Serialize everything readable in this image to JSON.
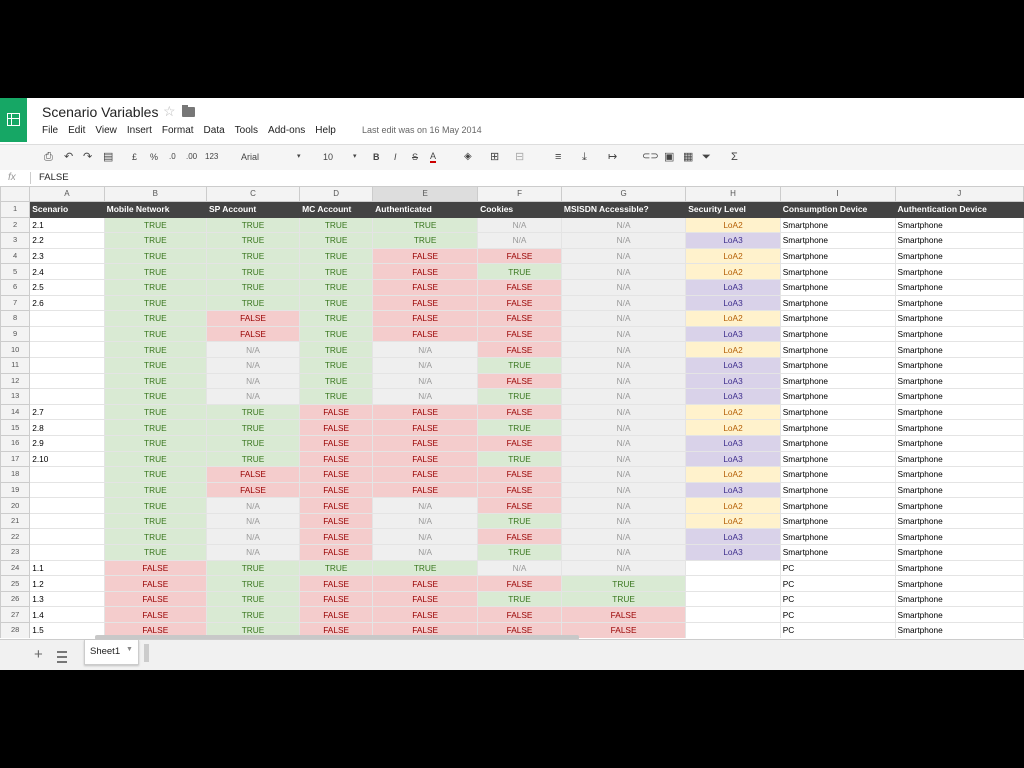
{
  "title_bar": {
    "doc_title": "Scenario Variables",
    "menu": [
      "File",
      "Edit",
      "View",
      "Insert",
      "Format",
      "Data",
      "Tools",
      "Add-ons",
      "Help"
    ],
    "last_edit": "Last edit was on 16 May 2014",
    "brand_color": "#16a765"
  },
  "toolbar": {
    "currency": "£",
    "percent": "%",
    "decrease_decimals": ".0",
    "increase_decimals": ".00",
    "more_formats": "123",
    "font": "Arial",
    "font_size": "10",
    "bold": "B",
    "italic": "I",
    "strikethrough": "S",
    "text_color": "A",
    "functions": "Σ"
  },
  "formula_bar": {
    "label": "fx",
    "value": "FALSE"
  },
  "sheet": {
    "columns": [
      "A",
      "B",
      "C",
      "D",
      "E",
      "F",
      "G",
      "H",
      "I",
      "J"
    ],
    "header_row": [
      "Scenario",
      "Mobile Network",
      "SP Account",
      "MC Account",
      "Authenticated",
      "Cookies",
      "MSISDN Accessible?",
      "Security Level",
      "Consumption Device",
      "Authentication Device"
    ],
    "rows": [
      [
        "2.1",
        "TRUE",
        "TRUE",
        "TRUE",
        "TRUE",
        "N/A",
        "N/A",
        "LoA2",
        "Smartphone",
        "Smartphone"
      ],
      [
        "2.2",
        "TRUE",
        "TRUE",
        "TRUE",
        "TRUE",
        "N/A",
        "N/A",
        "LoA3",
        "Smartphone",
        "Smartphone"
      ],
      [
        "2.3",
        "TRUE",
        "TRUE",
        "TRUE",
        "FALSE",
        "FALSE",
        "N/A",
        "LoA2",
        "Smartphone",
        "Smartphone"
      ],
      [
        "2.4",
        "TRUE",
        "TRUE",
        "TRUE",
        "FALSE",
        "TRUE",
        "N/A",
        "LoA2",
        "Smartphone",
        "Smartphone"
      ],
      [
        "2.5",
        "TRUE",
        "TRUE",
        "TRUE",
        "FALSE",
        "FALSE",
        "N/A",
        "LoA3",
        "Smartphone",
        "Smartphone"
      ],
      [
        "2.6",
        "TRUE",
        "TRUE",
        "TRUE",
        "FALSE",
        "FALSE",
        "N/A",
        "LoA3",
        "Smartphone",
        "Smartphone"
      ],
      [
        "",
        "TRUE",
        "FALSE",
        "TRUE",
        "FALSE",
        "FALSE",
        "N/A",
        "LoA2",
        "Smartphone",
        "Smartphone"
      ],
      [
        "",
        "TRUE",
        "FALSE",
        "TRUE",
        "FALSE",
        "FALSE",
        "N/A",
        "LoA3",
        "Smartphone",
        "Smartphone"
      ],
      [
        "",
        "TRUE",
        "N/A",
        "TRUE",
        "N/A",
        "FALSE",
        "N/A",
        "LoA2",
        "Smartphone",
        "Smartphone"
      ],
      [
        "",
        "TRUE",
        "N/A",
        "TRUE",
        "N/A",
        "TRUE",
        "N/A",
        "LoA3",
        "Smartphone",
        "Smartphone"
      ],
      [
        "",
        "TRUE",
        "N/A",
        "TRUE",
        "N/A",
        "FALSE",
        "N/A",
        "LoA3",
        "Smartphone",
        "Smartphone"
      ],
      [
        "",
        "TRUE",
        "N/A",
        "TRUE",
        "N/A",
        "TRUE",
        "N/A",
        "LoA3",
        "Smartphone",
        "Smartphone"
      ],
      [
        "2.7",
        "TRUE",
        "TRUE",
        "FALSE",
        "FALSE",
        "FALSE",
        "N/A",
        "LoA2",
        "Smartphone",
        "Smartphone"
      ],
      [
        "2.8",
        "TRUE",
        "TRUE",
        "FALSE",
        "FALSE",
        "TRUE",
        "N/A",
        "LoA2",
        "Smartphone",
        "Smartphone"
      ],
      [
        "2.9",
        "TRUE",
        "TRUE",
        "FALSE",
        "FALSE",
        "FALSE",
        "N/A",
        "LoA3",
        "Smartphone",
        "Smartphone"
      ],
      [
        "2.10",
        "TRUE",
        "TRUE",
        "FALSE",
        "FALSE",
        "TRUE",
        "N/A",
        "LoA3",
        "Smartphone",
        "Smartphone"
      ],
      [
        "",
        "TRUE",
        "FALSE",
        "FALSE",
        "FALSE",
        "FALSE",
        "N/A",
        "LoA2",
        "Smartphone",
        "Smartphone"
      ],
      [
        "",
        "TRUE",
        "FALSE",
        "FALSE",
        "FALSE",
        "FALSE",
        "N/A",
        "LoA3",
        "Smartphone",
        "Smartphone"
      ],
      [
        "",
        "TRUE",
        "N/A",
        "FALSE",
        "N/A",
        "FALSE",
        "N/A",
        "LoA2",
        "Smartphone",
        "Smartphone"
      ],
      [
        "",
        "TRUE",
        "N/A",
        "FALSE",
        "N/A",
        "TRUE",
        "N/A",
        "LoA2",
        "Smartphone",
        "Smartphone"
      ],
      [
        "",
        "TRUE",
        "N/A",
        "FALSE",
        "N/A",
        "FALSE",
        "N/A",
        "LoA3",
        "Smartphone",
        "Smartphone"
      ],
      [
        "",
        "TRUE",
        "N/A",
        "FALSE",
        "N/A",
        "TRUE",
        "N/A",
        "LoA3",
        "Smartphone",
        "Smartphone"
      ],
      [
        "1.1",
        "FALSE",
        "TRUE",
        "TRUE",
        "TRUE",
        "N/A",
        "N/A",
        "",
        "PC",
        "Smartphone"
      ],
      [
        "1.2",
        "FALSE",
        "TRUE",
        "FALSE",
        "FALSE",
        "FALSE",
        "TRUE",
        "",
        "PC",
        "Smartphone"
      ],
      [
        "1.3",
        "FALSE",
        "TRUE",
        "FALSE",
        "FALSE",
        "TRUE",
        "TRUE",
        "",
        "PC",
        "Smartphone"
      ],
      [
        "1.4",
        "FALSE",
        "TRUE",
        "FALSE",
        "FALSE",
        "FALSE",
        "FALSE",
        "",
        "PC",
        "Smartphone"
      ],
      [
        "1.5",
        "FALSE",
        "TRUE",
        "FALSE",
        "FALSE",
        "FALSE",
        "FALSE",
        "",
        "PC",
        "Smartphone"
      ]
    ]
  },
  "sheet_tabs": {
    "add": "+",
    "active": "Sheet1"
  }
}
